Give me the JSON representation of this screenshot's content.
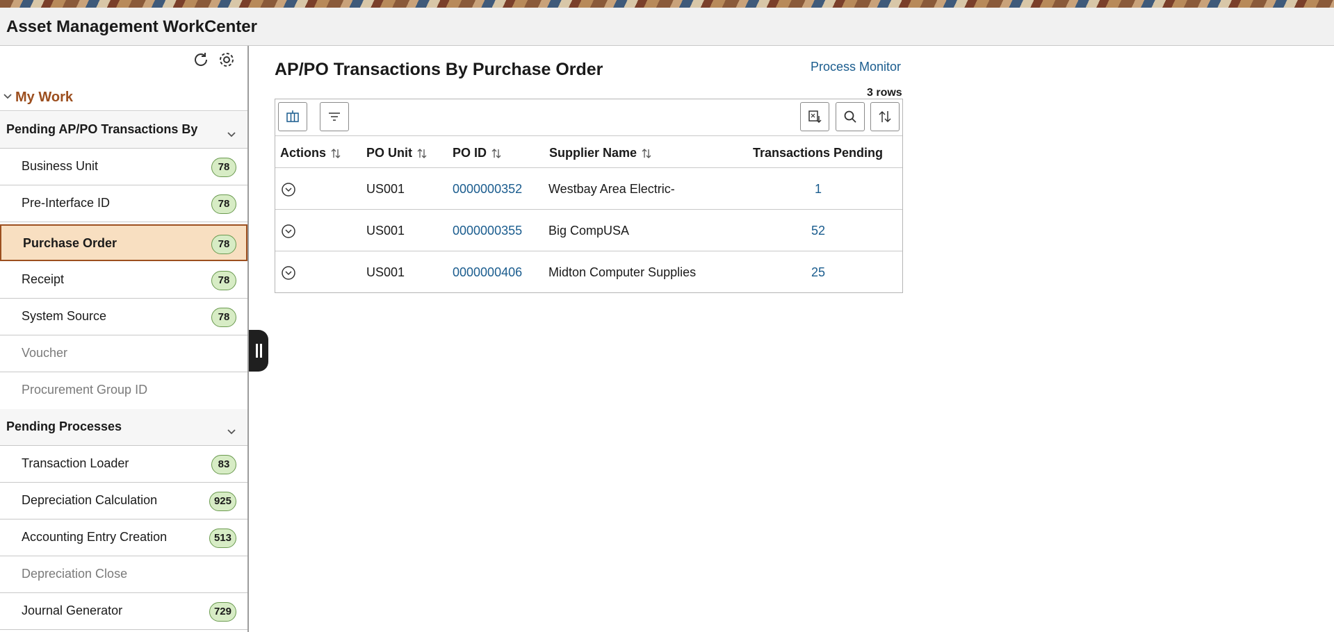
{
  "header": {
    "title": "Asset Management WorkCenter"
  },
  "sidebar": {
    "my_work_label": "My Work",
    "sections": [
      {
        "label": "Pending AP/PO Transactions By",
        "items": [
          {
            "label": "Business Unit",
            "count": "78"
          },
          {
            "label": "Pre-Interface ID",
            "count": "78"
          },
          {
            "label": "Purchase Order",
            "count": "78",
            "selected": true
          },
          {
            "label": "Receipt",
            "count": "78"
          },
          {
            "label": "System Source",
            "count": "78"
          },
          {
            "label": "Voucher",
            "count": ""
          },
          {
            "label": "Procurement Group ID",
            "count": ""
          }
        ]
      },
      {
        "label": "Pending Processes",
        "items": [
          {
            "label": "Transaction Loader",
            "count": "83"
          },
          {
            "label": "Depreciation Calculation",
            "count": "925"
          },
          {
            "label": "Accounting Entry Creation",
            "count": "513"
          },
          {
            "label": "Depreciation Close",
            "count": ""
          },
          {
            "label": "Journal Generator",
            "count": "729"
          }
        ]
      }
    ]
  },
  "main": {
    "title": "AP/PO Transactions By Purchase Order",
    "process_monitor": "Process Monitor",
    "row_count": "3 rows",
    "columns": [
      "Actions",
      "PO Unit",
      "PO ID",
      "Supplier Name",
      "Transactions Pending"
    ],
    "rows": [
      {
        "po_unit": "US001",
        "po_id": "0000000352",
        "supplier": "Westbay Area Electric-",
        "pending": "1"
      },
      {
        "po_unit": "US001",
        "po_id": "0000000355",
        "supplier": "Big CompUSA",
        "pending": "52"
      },
      {
        "po_unit": "US001",
        "po_id": "0000000406",
        "supplier": "Midton Computer Supplies",
        "pending": "25"
      }
    ]
  },
  "colors": {
    "accent": "#9c4f1f",
    "link": "#1a5c8e",
    "selected_bg": "#f8dfc1",
    "badge_bg": "#d7ecc5"
  }
}
